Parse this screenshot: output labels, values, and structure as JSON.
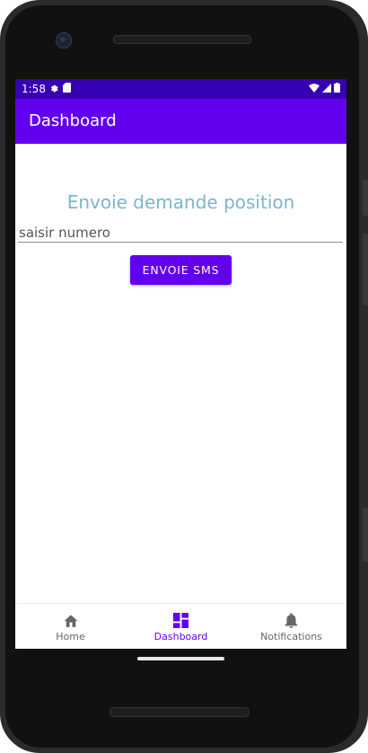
{
  "status_bar": {
    "time": "1:58",
    "left_icons": [
      "gear-icon",
      "sd-card-icon"
    ],
    "right_icons": [
      "wifi-icon",
      "signal-icon",
      "battery-icon"
    ]
  },
  "app_bar": {
    "title": "Dashboard"
  },
  "main": {
    "heading": "Envoie demande position",
    "number_input": {
      "value": "",
      "placeholder": "saisir numero"
    },
    "send_button_label": "ENVOIE SMS"
  },
  "bottom_nav": {
    "items": [
      {
        "label": "Home",
        "icon": "home-icon",
        "active": false
      },
      {
        "label": "Dashboard",
        "icon": "dashboard-icon",
        "active": true
      },
      {
        "label": "Notifications",
        "icon": "bell-icon",
        "active": false
      }
    ]
  },
  "colors": {
    "status_bar": "#3700b3",
    "primary": "#6200ee",
    "heading_text": "#7ab6cc",
    "inactive_nav": "#666666"
  }
}
